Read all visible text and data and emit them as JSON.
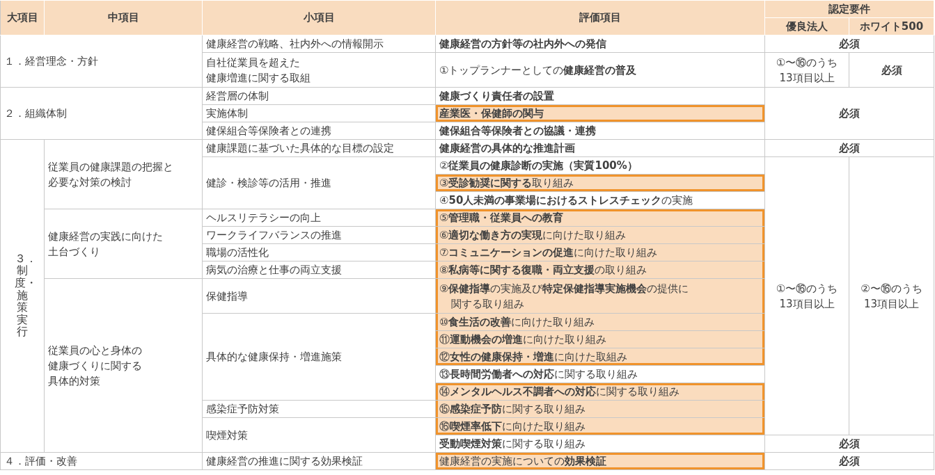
{
  "header": {
    "columns": [
      {
        "label": "大項目"
      },
      {
        "label": "中項目"
      },
      {
        "label": "小項目"
      },
      {
        "label": "評価項目"
      }
    ],
    "requirements": {
      "label": "認定要件",
      "columns": [
        {
          "label": "優良法人"
        },
        {
          "label": "ホワイト500"
        }
      ]
    }
  },
  "rows": [
    {
      "major": {
        "lines": [
          "１．経営理念・方針"
        ],
        "kind": "horizontal"
      },
      "minor": {
        "lines": [
          "健康経営の戦略、社内外への情報開示"
        ]
      },
      "item": {
        "lines": [
          "**健康経営の方針等の社内外への発信**"
        ],
        "highlighted": false
      },
      "requirement": {
        "kind": "joint",
        "values": [
          {
            "lines": [
              "必須"
            ],
            "kind": "required"
          }
        ]
      }
    },
    {
      "minor": {
        "lines": [
          "自社従業員を超えた",
          "健康増進に関する取組"
        ]
      },
      "item": {
        "lines": [
          "①トップランナーとしての**健康経営の普及**"
        ],
        "highlighted": false
      },
      "requirement": {
        "kind": "split",
        "values": [
          {
            "lines": [
              "①〜⑯のうち",
              "13項目以上"
            ],
            "kind": "count"
          },
          {
            "lines": [
              "必須"
            ],
            "kind": "required"
          }
        ]
      }
    },
    {
      "major": {
        "lines": [
          "２．組織体制"
        ],
        "kind": "horizontal"
      },
      "minor": {
        "lines": [
          "経営層の体制"
        ]
      },
      "item": {
        "lines": [
          "**健康づくり責任者の設置**"
        ],
        "highlighted": false
      },
      "requirement": {
        "kind": "joint",
        "values": [
          {
            "lines": [
              "必須"
            ],
            "kind": "required"
          }
        ]
      }
    },
    {
      "minor": {
        "lines": [
          "実施体制"
        ]
      },
      "item": {
        "lines": [
          "**産業医・保健師の関与**"
        ],
        "highlighted": true
      }
    },
    {
      "minor": {
        "lines": [
          "健保組合等保険者との連携"
        ]
      },
      "item": {
        "lines": [
          "**健保組合等保険者との協議・連携**"
        ],
        "highlighted": false
      }
    },
    {
      "major": {
        "lines": [
          "３．制度・施策実行"
        ],
        "kind": "vertical"
      },
      "middle": {
        "lines": [
          "従業員の健康課題の把握と",
          "必要な対策の検討"
        ]
      },
      "minor": {
        "lines": [
          "健康課題に基づいた具体的な目標の設定"
        ]
      },
      "item": {
        "lines": [
          "**健康経営の具体的な推進計画**"
        ],
        "highlighted": false
      },
      "requirement": {
        "kind": "joint",
        "values": [
          {
            "lines": [
              "必須"
            ],
            "kind": "required"
          }
        ]
      }
    },
    {
      "minor": {
        "lines": [
          "健診・検診等の活用・推進"
        ]
      },
      "item": {
        "lines": [
          "②**従業員の健康診断の実施（実質100%）**"
        ],
        "highlighted": false
      },
      "requirement": {
        "kind": "split",
        "values": [
          {
            "lines": [
              "①〜⑯のうち",
              "13項目以上"
            ],
            "kind": "count"
          },
          {
            "lines": [
              "②〜⑯のうち",
              "13項目以上"
            ],
            "kind": "count"
          }
        ]
      }
    },
    {
      "item": {
        "lines": [
          "③**受診勧奨に関する**取り組み"
        ],
        "highlighted": true
      }
    },
    {
      "item": {
        "lines": [
          "④**50人未満の事業場におけるストレスチェック**の実施"
        ],
        "highlighted": false
      }
    },
    {
      "middle": {
        "lines": [
          "健康経営の実践に向けた",
          "土台づくり"
        ]
      },
      "minor": {
        "lines": [
          "ヘルスリテラシーの向上"
        ]
      },
      "item": {
        "lines": [
          "⑤**管理職・従業員への教育**"
        ],
        "highlighted": true
      }
    },
    {
      "minor": {
        "lines": [
          "ワークライフバランスの推進"
        ]
      },
      "item": {
        "lines": [
          "⑥**適切な働き方の実現**に向けた取り組み"
        ],
        "highlighted": true
      }
    },
    {
      "minor": {
        "lines": [
          "職場の活性化"
        ]
      },
      "item": {
        "lines": [
          "⑦**コミュニケーションの促進**に向けた取り組み"
        ],
        "highlighted": true
      }
    },
    {
      "minor": {
        "lines": [
          "病気の治療と仕事の両立支援"
        ]
      },
      "item": {
        "lines": [
          "⑧**私病等に関する復職・両立支援**の取り組み"
        ],
        "highlighted": true
      }
    },
    {
      "middle": {
        "lines": [
          "従業員の心と身体の",
          "健康づくりに関する",
          "具体的対策"
        ]
      },
      "minor": {
        "lines": [
          "保健指導"
        ]
      },
      "item": {
        "lines": [
          "⑨**保健指導**の実施及び**特定保健指導実施機会**の提供に",
          "関する取り組み"
        ],
        "highlighted": true
      }
    },
    {
      "minor": {
        "lines": [
          "具体的な健康保持・増進施策"
        ]
      },
      "item": {
        "lines": [
          "⑩**食生活の改善**に向けた取り組み"
        ],
        "highlighted": true
      }
    },
    {
      "item": {
        "lines": [
          "⑪**運動機会の増進**に向けた取り組み"
        ],
        "highlighted": true
      }
    },
    {
      "item": {
        "lines": [
          "⑫**女性の健康保持・増進**に向けた取組み"
        ],
        "highlighted": true
      }
    },
    {
      "item": {
        "lines": [
          "⑬**長時間労働者への対応**に関する取り組み"
        ],
        "highlighted": false
      }
    },
    {
      "item": {
        "lines": [
          "⑭**メンタルヘルス不調者への対応**に関する取り組み"
        ],
        "highlighted": true
      }
    },
    {
      "minor": {
        "lines": [
          "感染症予防対策"
        ]
      },
      "item": {
        "lines": [
          "⑮**感染症予防**に関する取り組み"
        ],
        "highlighted": true
      }
    },
    {
      "minor": {
        "lines": [
          "喫煙対策"
        ]
      },
      "item": {
        "lines": [
          "⑯**喫煙率低下**に向けた取り組み"
        ],
        "highlighted": true
      }
    },
    {
      "item": {
        "lines": [
          "**受動喫煙対策**に関する取り組み"
        ],
        "highlighted": false
      },
      "requirement": {
        "kind": "joint",
        "values": [
          {
            "lines": [
              "必須"
            ],
            "kind": "required"
          }
        ]
      }
    },
    {
      "major": {
        "lines": [
          "４．評価・改善"
        ],
        "kind": "horizontal"
      },
      "minor": {
        "lines": [
          "健康経営の推進に関する効果検証"
        ]
      },
      "item": {
        "lines": [
          "健康経営の実施についての**効果検証**"
        ],
        "highlighted": true
      },
      "requirement": {
        "kind": "joint",
        "values": [
          {
            "lines": [
              "必須"
            ],
            "kind": "required"
          }
        ]
      }
    }
  ]
}
